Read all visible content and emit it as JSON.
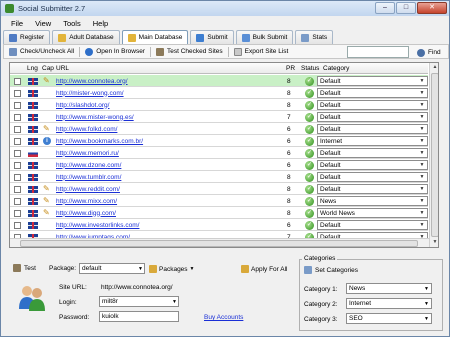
{
  "window": {
    "title": "Social Submitter 2.7",
    "minimize": "–",
    "maximize": "□",
    "close": "✕"
  },
  "menu": [
    "File",
    "View",
    "Tools",
    "Help"
  ],
  "tabs": [
    {
      "label": "Register",
      "icon": "register-icon"
    },
    {
      "label": "Adult Database",
      "icon": "folder-icon"
    },
    {
      "label": "Main Database",
      "icon": "folder-icon"
    },
    {
      "label": "Submit",
      "icon": "submit-icon"
    },
    {
      "label": "Bulk Submit",
      "icon": "bulk-submit-icon"
    },
    {
      "label": "Stats",
      "icon": "stats-icon"
    }
  ],
  "toolbar": {
    "check_uncheck": "Check/Uncheck All",
    "open_browser": "Open In Browser",
    "test_checked": "Test Checked Sites",
    "export": "Export Site List",
    "search_value": "",
    "find": "Find"
  },
  "grid": {
    "columns": [
      "Lng",
      "Cap",
      "URL",
      "PR",
      "Status",
      "Category"
    ],
    "rows": [
      {
        "lang": "uk",
        "cap": "pen",
        "url": "http://www.connotea.org/",
        "pr": "8",
        "category": "Default"
      },
      {
        "lang": "uk",
        "cap": "",
        "url": "http://mister-wong.com/",
        "pr": "8",
        "category": "Default"
      },
      {
        "lang": "uk",
        "cap": "",
        "url": "http://slashdot.org/",
        "pr": "8",
        "category": "Default"
      },
      {
        "lang": "uk",
        "cap": "",
        "url": "http://www.mister-wong.es/",
        "pr": "7",
        "category": "Default"
      },
      {
        "lang": "uk",
        "cap": "pen",
        "url": "http://www.folkd.com/",
        "pr": "6",
        "category": "Default"
      },
      {
        "lang": "uk",
        "cap": "info",
        "url": "http://www.bookmarks.com.br/",
        "pr": "6",
        "category": "Internet"
      },
      {
        "lang": "ru",
        "cap": "",
        "url": "http://www.memori.ru/",
        "pr": "6",
        "category": "Default"
      },
      {
        "lang": "uk",
        "cap": "",
        "url": "http://www.dzone.com/",
        "pr": "6",
        "category": "Default"
      },
      {
        "lang": "uk",
        "cap": "",
        "url": "http://www.tumblr.com/",
        "pr": "8",
        "category": "Default"
      },
      {
        "lang": "uk",
        "cap": "pen",
        "url": "http://www.reddit.com/",
        "pr": "8",
        "category": "Default"
      },
      {
        "lang": "uk",
        "cap": "pen",
        "url": "http://www.mixx.com/",
        "pr": "8",
        "category": "News"
      },
      {
        "lang": "uk",
        "cap": "pen",
        "url": "http://www.digg.com/",
        "pr": "8",
        "category": "World News"
      },
      {
        "lang": "uk",
        "cap": "",
        "url": "http://www.investorlinks.com/",
        "pr": "6",
        "category": "Default"
      },
      {
        "lang": "uk",
        "cap": "",
        "url": "http://www.jumptags.com/",
        "pr": "7",
        "category": "Default"
      }
    ]
  },
  "account": {
    "test_label": "Test",
    "package_label": "Package:",
    "package_value": "default",
    "packages_button": "Packages",
    "apply_all": "Apply For All",
    "site_url_label": "Site URL:",
    "site_url_value": "http://www.connotea.org/",
    "login_label": "Login:",
    "login_value": "milt8r",
    "password_label": "Password:",
    "password_value": "kuiolk",
    "buy_accounts": "Buy Accounts"
  },
  "categories": {
    "group_title": "Categories",
    "set_button": "Set Categories",
    "cat1_label": "Category 1:",
    "cat1_value": "News",
    "cat2_label": "Category 2:",
    "cat2_value": "Internet",
    "cat3_label": "Category 3:",
    "cat3_value": "SEO"
  }
}
